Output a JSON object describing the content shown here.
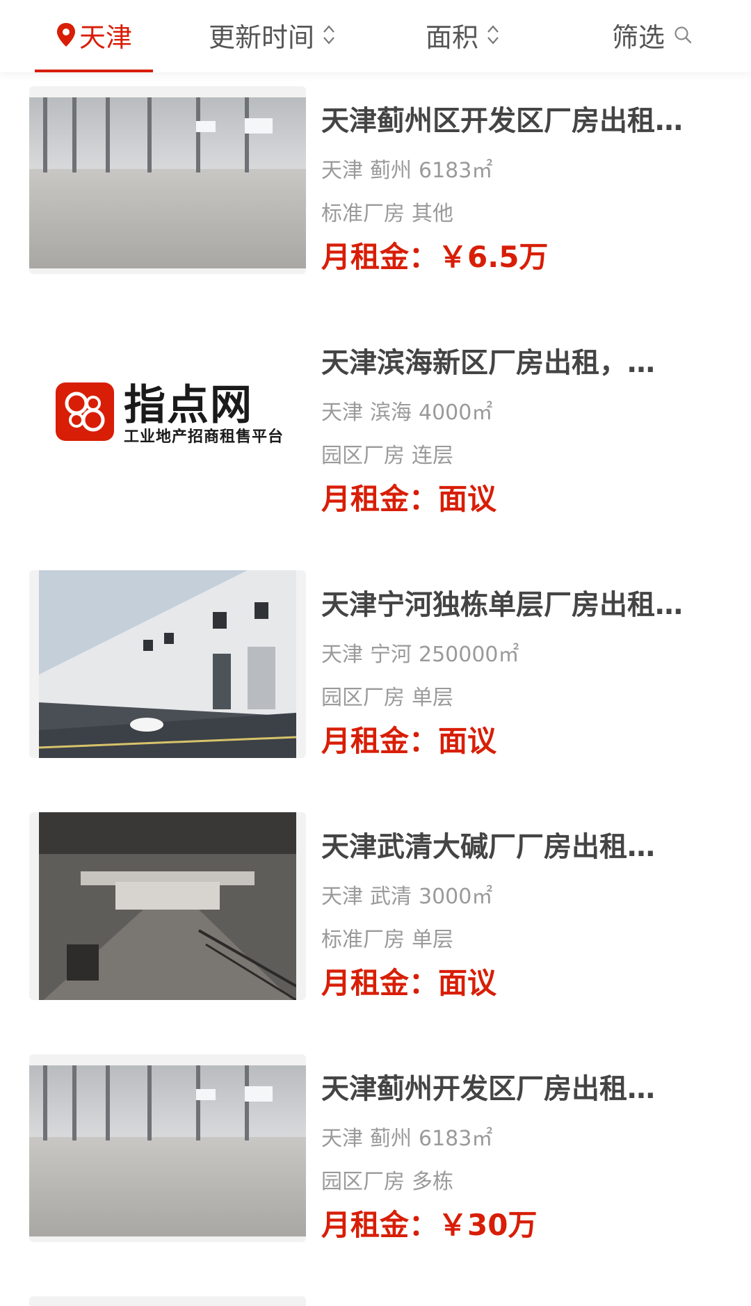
{
  "filter_bar": {
    "city_label": "天津",
    "update_time_label": "更新时间",
    "area_label": "面积",
    "filter_label": "筛选",
    "accent_color": "#d81e06"
  },
  "listings": [
    {
      "title": "天津蓟州区开发区厂房出租，…",
      "city": "天津",
      "district": "蓟州",
      "area": "6183㎡",
      "type": "标准厂房",
      "subtype": "其他",
      "price_label": "月租金：",
      "price_value": "￥6.5万",
      "image": "warehouse-interior-photo"
    },
    {
      "title": "天津滨海新区厂房出租，…",
      "city": "天津",
      "district": "滨海",
      "area": "4000㎡",
      "type": "园区厂房",
      "subtype": "连层",
      "price_label": "月租金：",
      "price_value": "面议",
      "image": "zhidianwang-logo",
      "logo_text": "指点网",
      "logo_subtitle": "工业地产招商租售平台"
    },
    {
      "title": "天津宁河独栋单层厂房出租…",
      "city": "天津",
      "district": "宁河",
      "area": "250000㎡",
      "type": "园区厂房",
      "subtype": "单层",
      "price_label": "月租金：",
      "price_value": "面议",
      "image": "factory-building-exterior-photo"
    },
    {
      "title": "天津武清大碱厂厂房出租…",
      "city": "天津",
      "district": "武清",
      "area": "3000㎡",
      "type": "标准厂房",
      "subtype": "单层",
      "price_label": "月租金：",
      "price_value": "面议",
      "image": "workshop-interior-photo"
    },
    {
      "title": "天津蓟州开发区厂房出租…",
      "city": "天津",
      "district": "蓟州",
      "area": "6183㎡",
      "type": "园区厂房",
      "subtype": "多栋",
      "price_label": "月租金：",
      "price_value": "￥30万",
      "image": "warehouse-interior-photo"
    }
  ]
}
